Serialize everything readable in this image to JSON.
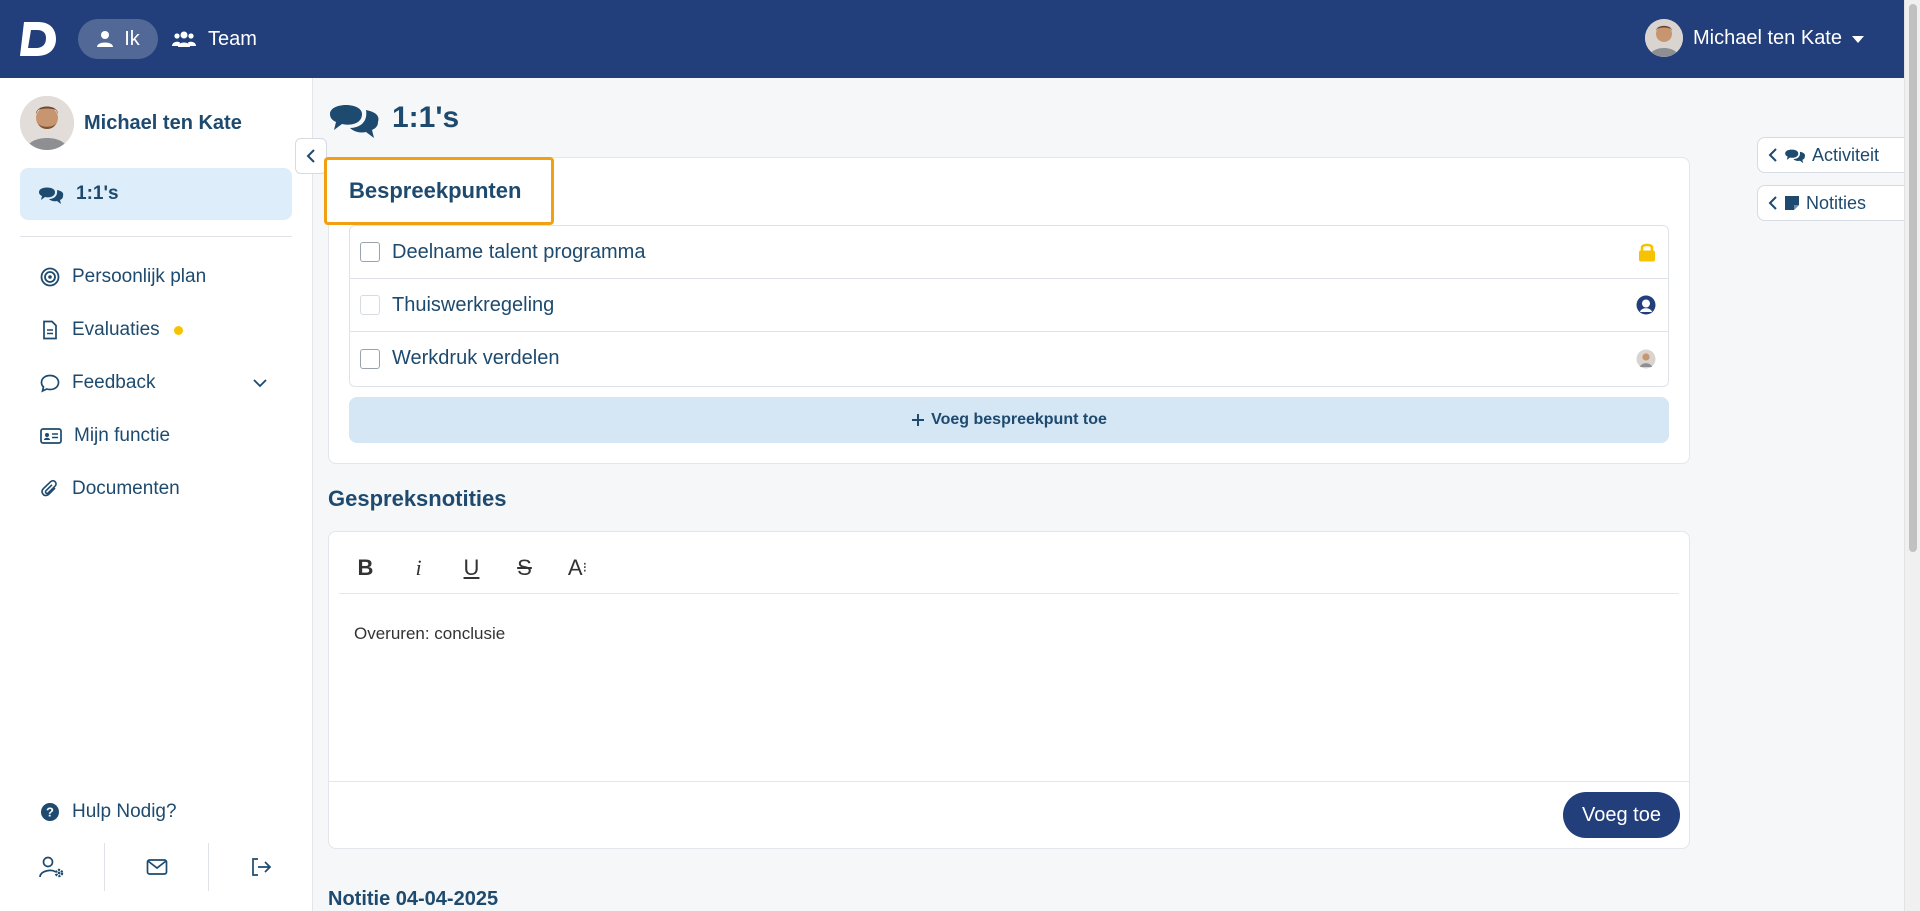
{
  "topbar": {
    "logo_text": "D",
    "nav": [
      {
        "label": "Ik",
        "icon": "user-icon",
        "active": true
      },
      {
        "label": "Team",
        "icon": "users-icon",
        "active": false
      }
    ],
    "user_name": "Michael ten Kate"
  },
  "sidebar": {
    "profile_name": "Michael ten Kate",
    "active_item": {
      "label": "1:1's",
      "icon": "comments-icon"
    },
    "items": [
      {
        "label": "Persoonlijk plan",
        "icon": "target-icon"
      },
      {
        "label": "Evaluaties",
        "icon": "document-icon",
        "has_dot": true
      },
      {
        "label": "Feedback",
        "icon": "chat-bubble-icon",
        "expandable": true
      },
      {
        "label": "Mijn functie",
        "icon": "id-card-icon"
      },
      {
        "label": "Documenten",
        "icon": "paperclip-icon"
      }
    ],
    "help_label": "Hulp Nodig?",
    "bottom_icons": [
      "user-settings-icon",
      "envelope-icon",
      "logout-icon"
    ]
  },
  "page": {
    "title": "1:1's"
  },
  "bespreekpunten": {
    "heading": "Bespreekpunten",
    "items": [
      {
        "label": "Deelname talent programma",
        "trailing_icon": "lock-icon"
      },
      {
        "label": "Thuiswerkregeling",
        "trailing_icon": "user-avatar-icon"
      },
      {
        "label": "Werkdruk verdelen",
        "trailing_icon": "photo-avatar-icon"
      }
    ],
    "add_label": "Voeg bespreekpunt toe"
  },
  "gespreksnotities": {
    "heading": "Gespreksnotities",
    "toolbar": [
      "B",
      "i",
      "U",
      "S",
      "A"
    ],
    "content": "Overuren: conclusie",
    "submit_label": "Voeg toe"
  },
  "note": {
    "title": "Notitie 04-04-2025"
  },
  "right_panel": {
    "tabs": [
      {
        "label": "Activiteit",
        "icon": "comments-icon"
      },
      {
        "label": "Notities",
        "icon": "sticky-note-icon"
      }
    ]
  },
  "colors": {
    "topbar": "#223f7b",
    "primary_text": "#1d4a6e",
    "highlight_border": "#f29f12",
    "active_bg": "#ddeefa",
    "lock": "#f7c300"
  }
}
